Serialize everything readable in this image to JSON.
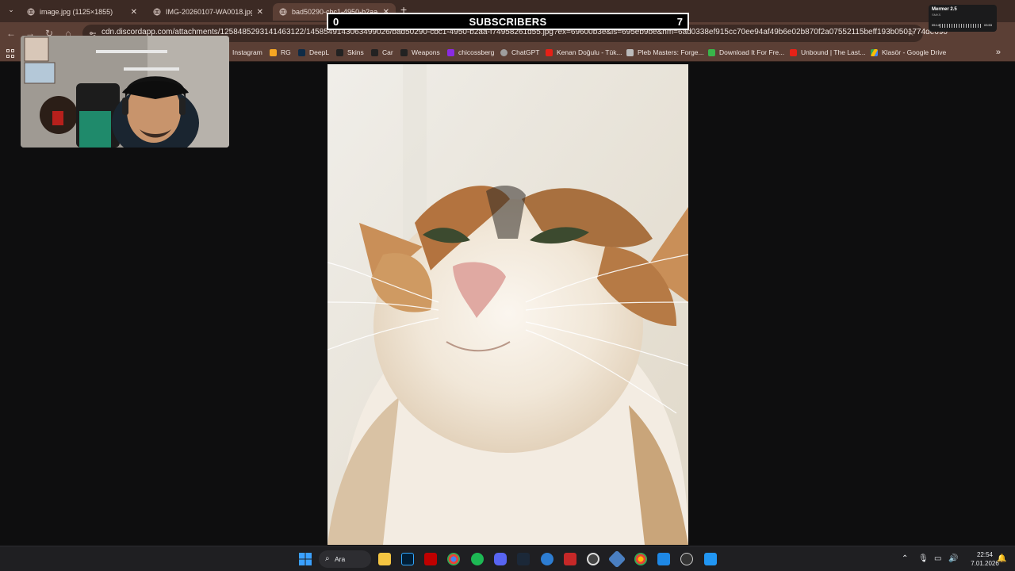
{
  "browser": {
    "tabs": [
      {
        "title": "image.jpg (1125×1855)",
        "active": false
      },
      {
        "title": "IMG-20260107-WA0018.jpg (11",
        "active": false
      },
      {
        "title": "bad50290-cbc1-4950-b2aa-f74",
        "active": true
      }
    ],
    "url": "cdn.discordapp.com/attachments/1258485293141463122/1458549143063499026/bad50290-cbc1-4950-b2aa-f74958261d55.jpg?ex=69600b3e&is=695eb9be&hm=6ad0338ef915cc70ee94af49b6e02b870f2a07552115beff193b0501774de690",
    "bookmarks": [
      {
        "label": "Instagram",
        "color": "#c13584"
      },
      {
        "label": "RG",
        "color": "#f5a623"
      },
      {
        "label": "DeepL",
        "color": "#0f2b46"
      },
      {
        "label": "Skins",
        "color": "#222"
      },
      {
        "label": "Car",
        "color": "#222"
      },
      {
        "label": "Weapons",
        "color": "#222"
      },
      {
        "label": "chicossberg",
        "color": "#8a2be2"
      },
      {
        "label": "ChatGPT",
        "color": "#9e9e9e"
      },
      {
        "label": "Kenan Doğulu - Tük...",
        "color": "#e62117"
      },
      {
        "label": "Pleb Masters: Forge...",
        "color": "#bbbbbb"
      },
      {
        "label": "Download It For Fre...",
        "color": "#39b54a"
      },
      {
        "label": "Unbound | The Last...",
        "color": "#e62117"
      },
      {
        "label": "Klasör - Google Drive",
        "color": "#fbbc04"
      }
    ]
  },
  "overlay": {
    "subscribers_left": "0",
    "subscribers_label": "SUBSCRIBERS",
    "subscribers_right": "7"
  },
  "media_widget": {
    "title": "Mermer 2.5",
    "artist": "SMKS",
    "elapsed": "05:14",
    "total": "03:53"
  },
  "taskbar": {
    "search_label": "Ara",
    "time": "22:54",
    "date": "7.01.2026"
  }
}
